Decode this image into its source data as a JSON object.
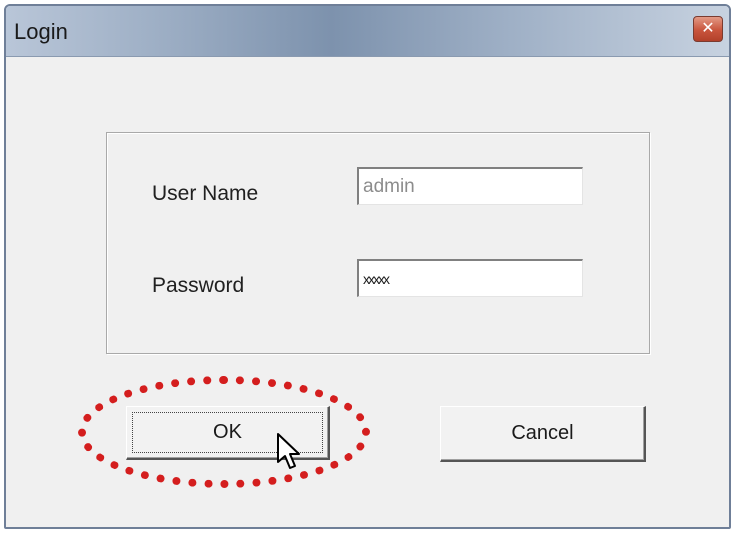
{
  "window": {
    "title": "Login",
    "close_glyph": "✕"
  },
  "form": {
    "username_label": "User Name",
    "username_value": "admin",
    "password_label": "Password",
    "password_value": "xxxxx"
  },
  "buttons": {
    "ok_label": "OK",
    "cancel_label": "Cancel"
  },
  "annotation": {
    "highlight_color": "#d41e1e"
  },
  "icons": {
    "cursor": "mouse-pointer-icon"
  }
}
